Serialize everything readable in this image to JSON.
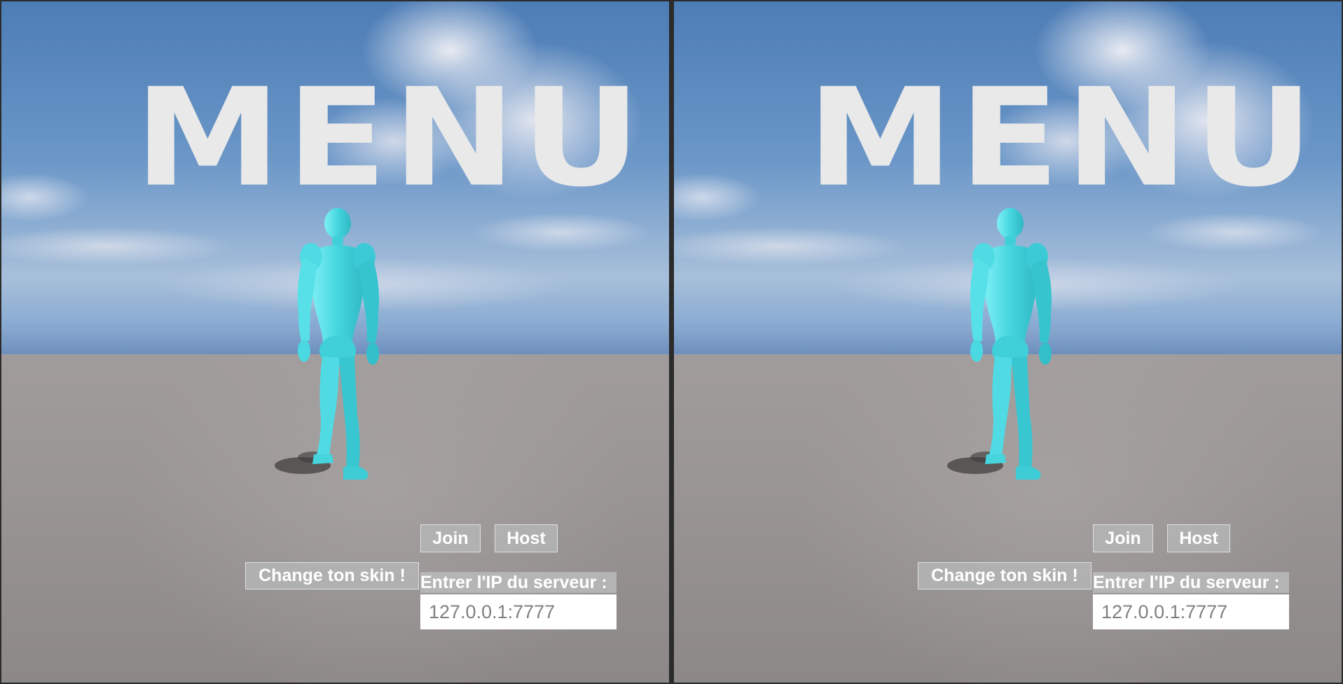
{
  "menu": {
    "title": "MENU",
    "join_label": "Join",
    "host_label": "Host",
    "skin_label": "Change ton skin !",
    "ip_label": "Entrer l'IP du serveur :",
    "ip_value": "127.0.0.1:7777"
  },
  "colors": {
    "character": "#4ad8e0",
    "sky": "#5f8fc4",
    "ground": "#9a9595"
  }
}
